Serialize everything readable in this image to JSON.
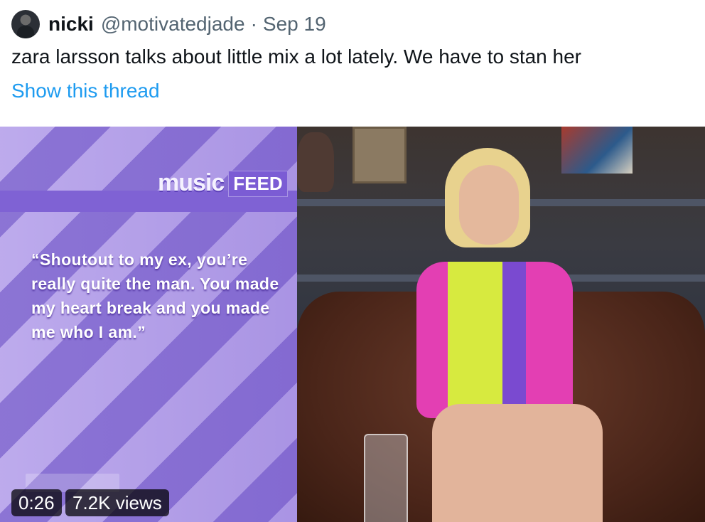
{
  "tweet": {
    "display_name": "nicki",
    "handle": "@motivatedjade",
    "separator": "·",
    "date": "Sep 19",
    "text": "zara larsson talks about little mix a lot lately. We have to stan her",
    "show_thread": "Show this thread"
  },
  "video": {
    "overlay": {
      "logo_word": "music",
      "logo_badge": "FEED",
      "quote": "“Shoutout to my ex, you’re really quite the man. You made my heart break and you made me who I am.”"
    },
    "duration": "0:26",
    "views": "7.2K views"
  },
  "colors": {
    "link_blue": "#1d9bf0",
    "purple_stripe": "#8f78d6",
    "purple_light": "#c9b8f2",
    "badge_bg": "#000000"
  },
  "icons": [
    "avatar"
  ]
}
